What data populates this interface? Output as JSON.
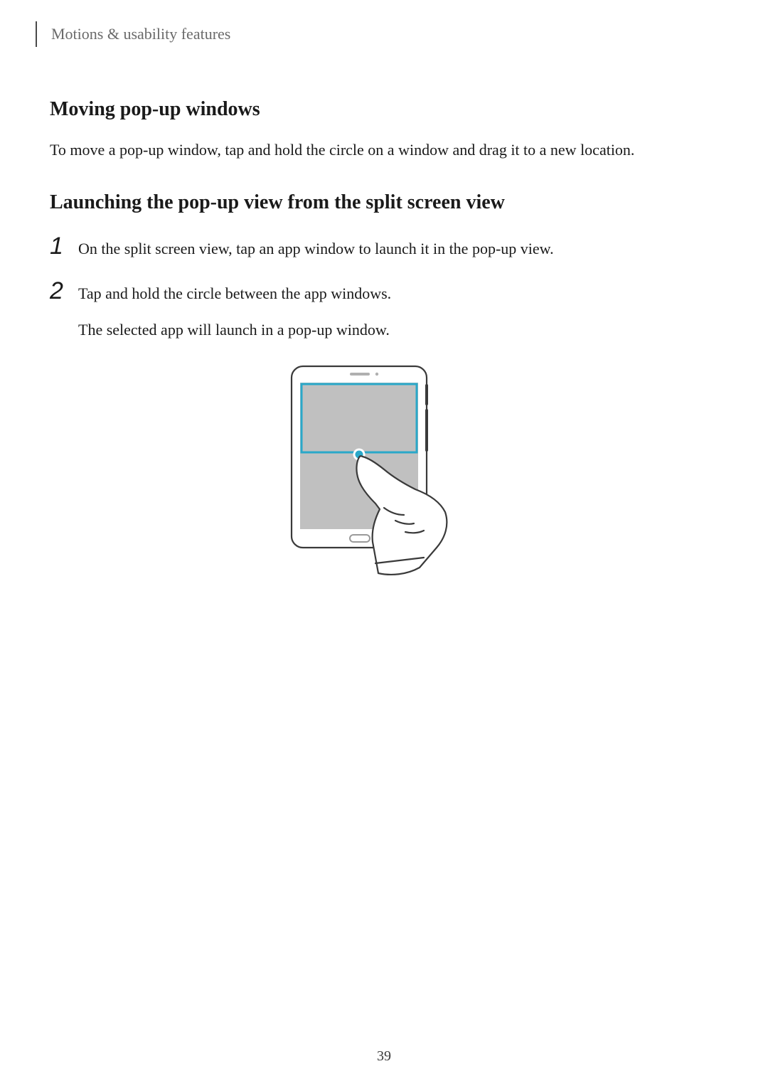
{
  "breadcrumb": "Motions & usability features",
  "section1": {
    "heading": "Moving pop-up windows",
    "body": "To move a pop-up window, tap and hold the circle on a window and drag it to a new location."
  },
  "section2": {
    "heading": "Launching the pop-up view from the split screen view",
    "steps": [
      {
        "number": "1",
        "text": "On the split screen view, tap an app window to launch it in the pop-up view."
      },
      {
        "number": "2",
        "text": "Tap and hold the circle between the app windows.",
        "subtext": "The selected app will launch in a pop-up window."
      }
    ]
  },
  "pageNumber": "39"
}
